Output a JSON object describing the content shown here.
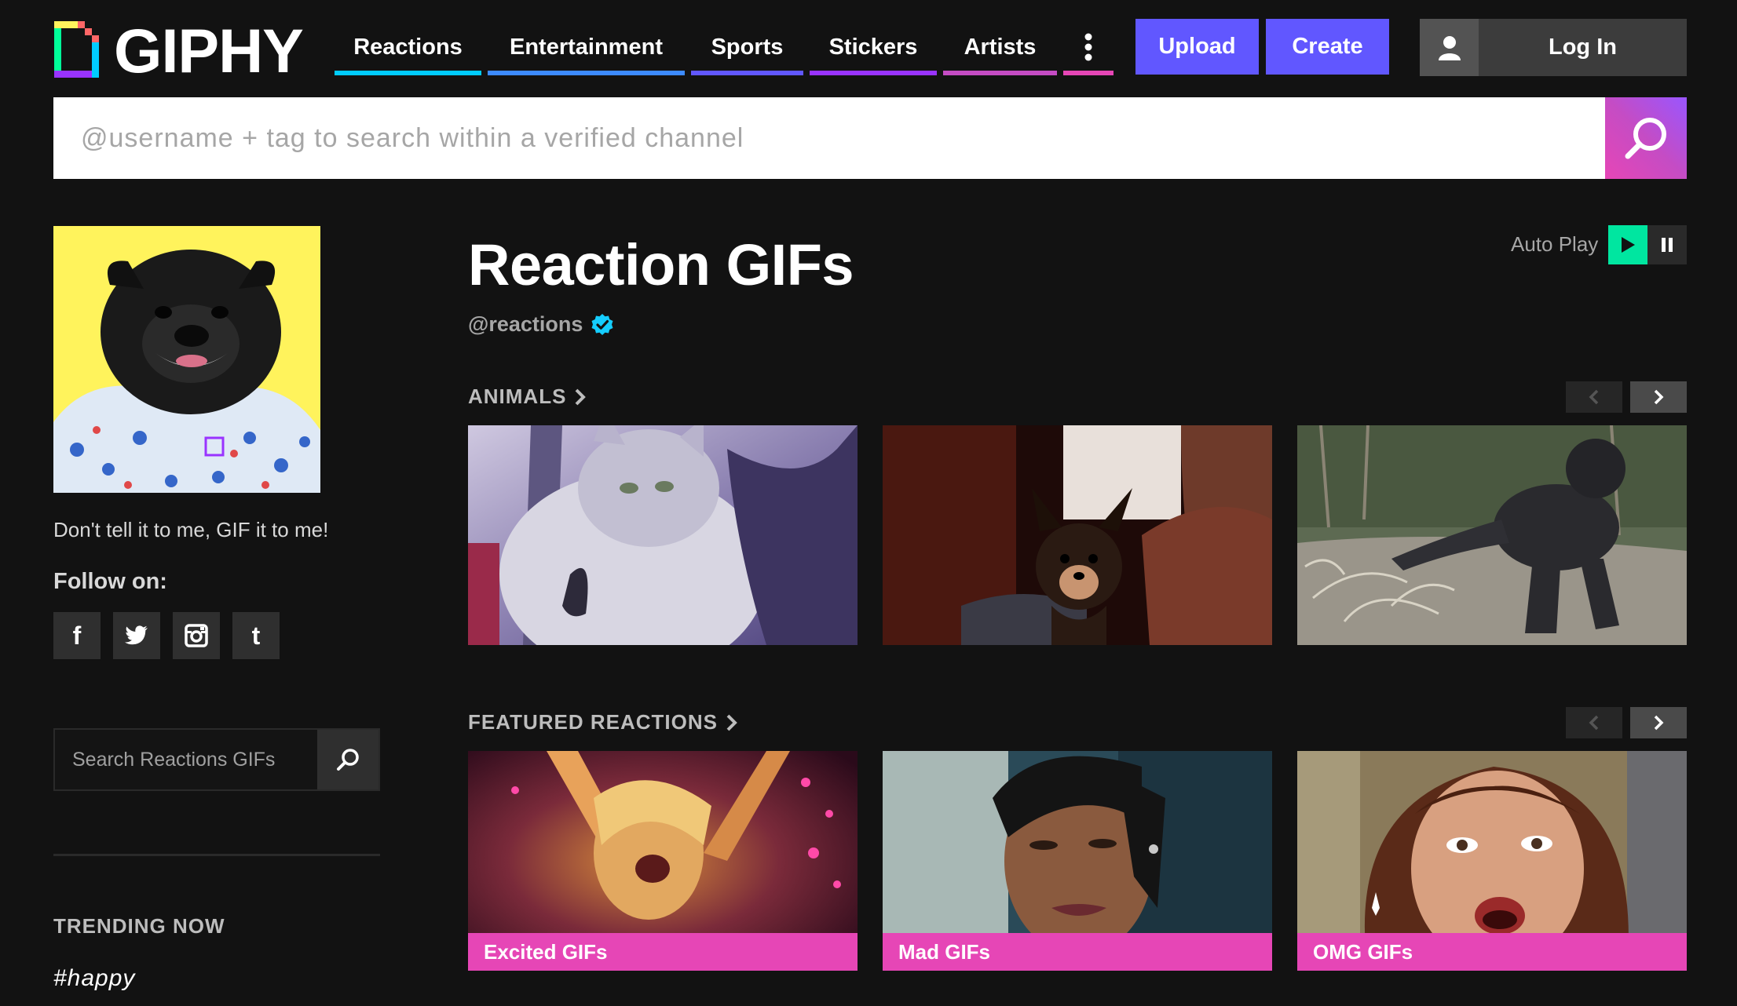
{
  "header": {
    "logo_text": "GIPHY",
    "nav": [
      {
        "label": "Reactions",
        "color": "#00ccff"
      },
      {
        "label": "Entertainment",
        "color": "#3d8bff"
      },
      {
        "label": "Sports",
        "color": "#6157ff"
      },
      {
        "label": "Stickers",
        "color": "#9933ff"
      },
      {
        "label": "Artists",
        "color": "#c54cc4"
      },
      {
        "label": "",
        "color": "#e646b6"
      }
    ],
    "upload_label": "Upload",
    "create_label": "Create",
    "login_label": "Log In"
  },
  "search": {
    "placeholder": "@username + tag to search within a verified channel"
  },
  "sidebar": {
    "tagline": "Don't tell it to me, GIF it to me!",
    "follow_label": "Follow on:",
    "social": [
      {
        "icon": "facebook-icon",
        "glyph": "f"
      },
      {
        "icon": "twitter-icon",
        "glyph": ""
      },
      {
        "icon": "instagram-icon",
        "glyph": ""
      },
      {
        "icon": "tumblr-icon",
        "glyph": "t"
      }
    ],
    "search_placeholder": "Search Reactions GIFs",
    "trending_title": "TRENDING NOW",
    "trending": [
      "#happy"
    ]
  },
  "main": {
    "title": "Reaction GIFs",
    "handle": "@reactions",
    "autoplay_label": "Auto Play",
    "sections": [
      {
        "title": "ANIMALS",
        "items": [
          {
            "caption": "",
            "subject": "kitten"
          },
          {
            "caption": "",
            "subject": "chihuahua"
          },
          {
            "caption": "",
            "subject": "gorilla"
          }
        ]
      },
      {
        "title": "FEATURED REACTIONS",
        "items": [
          {
            "caption": "Excited GIFs",
            "subject": "excited"
          },
          {
            "caption": "Mad GIFs",
            "subject": "mad"
          },
          {
            "caption": "OMG GIFs",
            "subject": "omg"
          }
        ]
      }
    ]
  },
  "colors": {
    "background": "#121212",
    "accent_purple": "#6157ff",
    "accent_pink": "#e646b6",
    "verified_blue": "#15cdff",
    "autoplay_green": "#00e6a0"
  }
}
